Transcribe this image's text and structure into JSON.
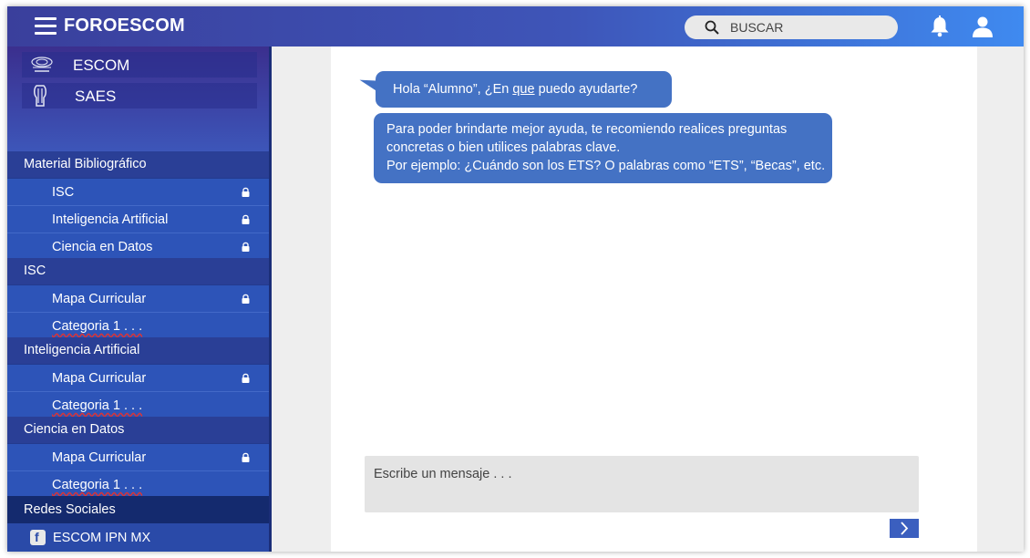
{
  "header": {
    "brand": "FOROESCOM",
    "search_placeholder": "BUSCAR"
  },
  "sidebar": {
    "links": [
      {
        "label": "ESCOM",
        "icon": "escom-logo-icon"
      },
      {
        "label": "SAES",
        "icon": "ipn-logo-icon"
      }
    ],
    "sections": [
      {
        "title": "Material Bibliográfico",
        "items": [
          {
            "label": "ISC",
            "locked": true
          },
          {
            "label": "Inteligencia Artificial",
            "locked": true
          },
          {
            "label": "Ciencia en Datos",
            "locked": true
          }
        ]
      },
      {
        "title": "ISC",
        "items": [
          {
            "label": "Mapa Curricular",
            "locked": true
          },
          {
            "label": "Categoria 1 . . .",
            "locked": false
          }
        ]
      },
      {
        "title": "Inteligencia Artificial",
        "items": [
          {
            "label": "Mapa Curricular",
            "locked": true
          },
          {
            "label": "Categoria 1 . . .",
            "locked": false
          }
        ]
      },
      {
        "title": "Ciencia en Datos",
        "items": [
          {
            "label": "Mapa Curricular",
            "locked": true
          },
          {
            "label": "Categoria 1 . . .",
            "locked": false
          }
        ]
      }
    ],
    "social": {
      "title": "Redes Sociales",
      "item": {
        "label": "ESCOM IPN MX",
        "icon": "facebook-icon"
      }
    }
  },
  "chat": {
    "greeting_pre": "Hola “Alumno”, ¿En ",
    "greeting_u": "que",
    "greeting_post": " puedo ayudarte?",
    "help_lines": [
      "Para poder brindarte mejor ayuda, te recomiendo realices preguntas",
      "concretas o bien utilices palabras clave.",
      "Por ejemplo: ¿Cuándo son los ETS? O palabras como “ETS”, “Becas”, etc."
    ],
    "input_placeholder": "Escribe un mensaje . . ."
  },
  "colors": {
    "accent": "#4472c4",
    "sidebar": "#233a8e",
    "topbar_start": "#3a3f9c",
    "topbar_end": "#3f8af0"
  }
}
